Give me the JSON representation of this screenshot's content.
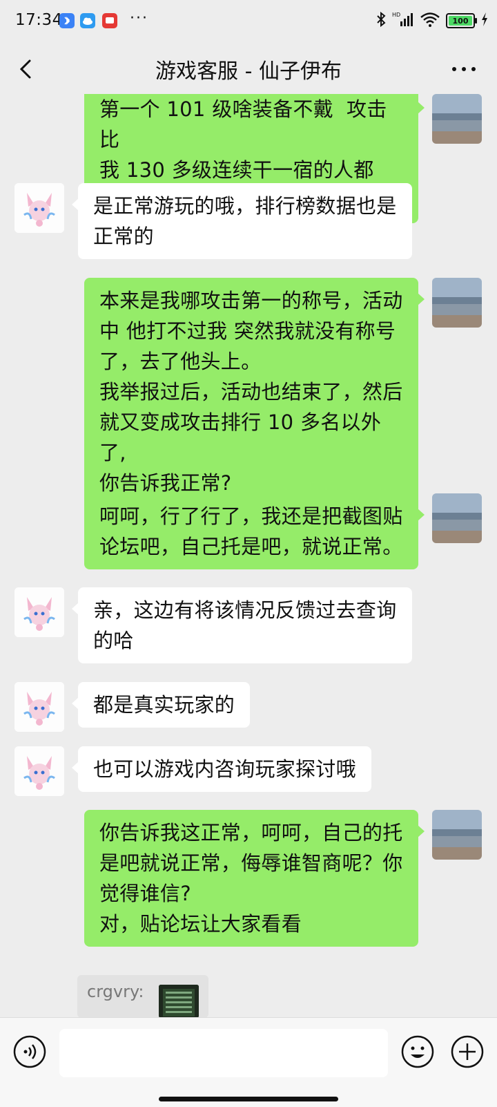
{
  "status_bar": {
    "time": "17:34",
    "icons": [
      "bluetooth-app-icon",
      "cloud-app-icon",
      "red-app-icon"
    ],
    "more_dots": "···",
    "battery": "100"
  },
  "header": {
    "title": "游戏客服 - 仙子伊布",
    "back_icon": "chevron-left-icon",
    "more_icon": "more-dots-icon"
  },
  "messages": [
    {
      "sender": "me",
      "text": "第一个 101 级啥装备不戴  攻击比\n我 130 多级连续干一宿的人都高?"
    },
    {
      "sender": "them",
      "text": "是正常游玩的哦，排行榜数据也是\n正常的"
    },
    {
      "sender": "me",
      "text": "本来是我哪攻击第一的称号，活动\n中 他打不过我 突然我就没有称号\n了，去了他头上。\n我举报过后，活动也结束了，然后\n就又变成攻击排行 10 多名以外了,\n你告诉我正常?"
    },
    {
      "sender": "me",
      "text": "呵呵，行了行了，我还是把截图贴\n论坛吧，自己托是吧，就说正常。"
    },
    {
      "sender": "them",
      "text": "亲，这边有将该情况反馈过去查询\n的哈"
    },
    {
      "sender": "them",
      "text": "都是真实玩家的"
    },
    {
      "sender": "them",
      "text": "也可以游戏内咨询玩家探讨哦"
    },
    {
      "sender": "me",
      "text": "你告诉我这正常，呵呵，自己的托\n是吧就说正常，侮辱谁智商呢？你\n觉得谁信?\n对，贴论坛让大家看看"
    }
  ],
  "quote": {
    "name": "crgvry:"
  },
  "input_bar": {
    "placeholder": "",
    "voice_icon": "voice-icon",
    "emoji_icon": "emoji-icon",
    "plus_icon": "plus-icon"
  },
  "colors": {
    "background": "#ededed",
    "my_bubble": "#95ec69",
    "their_bubble": "#ffffff"
  }
}
